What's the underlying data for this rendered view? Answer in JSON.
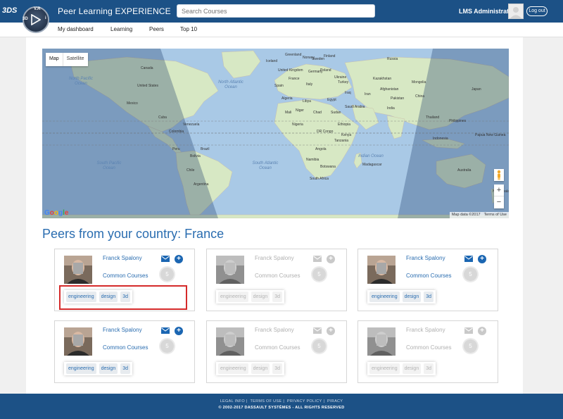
{
  "header": {
    "brand_mark": "3DS",
    "app_title": "Peer Learning EXPERIENCE",
    "search_placeholder": "Search Courses",
    "user_name": "LMS Administrator",
    "logout_label": "Log out",
    "compass_letters": {
      "n": "V.R",
      "w": "3D",
      "e": "i"
    }
  },
  "nav": {
    "items": [
      {
        "label": "My dashboard"
      },
      {
        "label": "Learning"
      },
      {
        "label": "Peers"
      },
      {
        "label": "Top 10"
      }
    ]
  },
  "map": {
    "toggle_map": "Map",
    "toggle_satellite": "Satellite",
    "google_logo": "Google",
    "attribution": "Map data ©2017",
    "terms": "Terms of Use",
    "zoom_in": "+",
    "zoom_out": "−",
    "labels": [
      {
        "text": "Greenland"
      },
      {
        "text": "Iceland"
      },
      {
        "text": "Norway"
      },
      {
        "text": "Sweden"
      },
      {
        "text": "Finland"
      },
      {
        "text": "Russia"
      },
      {
        "text": "Canada"
      },
      {
        "text": "United Kingdom"
      },
      {
        "text": "Germany"
      },
      {
        "text": "Poland"
      },
      {
        "text": "Ukraine"
      },
      {
        "text": "Kazakhstan"
      },
      {
        "text": "Mongolia"
      },
      {
        "text": "France"
      },
      {
        "text": "Spain"
      },
      {
        "text": "Italy"
      },
      {
        "text": "Turkey"
      },
      {
        "text": "China"
      },
      {
        "text": "United States"
      },
      {
        "text": "Mexico"
      },
      {
        "text": "Algeria"
      },
      {
        "text": "Libya"
      },
      {
        "text": "Egypt"
      },
      {
        "text": "Iraq"
      },
      {
        "text": "Iran"
      },
      {
        "text": "Afghanistan"
      },
      {
        "text": "Pakistan"
      },
      {
        "text": "India"
      },
      {
        "text": "Saudi Arabia"
      },
      {
        "text": "Mali"
      },
      {
        "text": "Niger"
      },
      {
        "text": "Chad"
      },
      {
        "text": "Sudan"
      },
      {
        "text": "Nigeria"
      },
      {
        "text": "Ethiopia"
      },
      {
        "text": "DR Congo"
      },
      {
        "text": "Kenya"
      },
      {
        "text": "Tanzania"
      },
      {
        "text": "Angola"
      },
      {
        "text": "Namibia"
      },
      {
        "text": "Botswana"
      },
      {
        "text": "Madagascar"
      },
      {
        "text": "South Africa"
      },
      {
        "text": "Cuba"
      },
      {
        "text": "Venezuela"
      },
      {
        "text": "Colombia"
      },
      {
        "text": "Peru"
      },
      {
        "text": "Brazil"
      },
      {
        "text": "Bolivia"
      },
      {
        "text": "Chile"
      },
      {
        "text": "Argentina"
      },
      {
        "text": "Indonesia"
      },
      {
        "text": "Philippines"
      },
      {
        "text": "Papua New Guinea"
      },
      {
        "text": "Australia"
      },
      {
        "text": "New Zealand"
      },
      {
        "text": "Japan"
      },
      {
        "text": "Thailand"
      }
    ],
    "oceans": [
      "North Atlantic Ocean",
      "South Atlantic Ocean",
      "Indian Ocean",
      "South Pacific Ocean",
      "North Pacific Ocean"
    ]
  },
  "peers": {
    "heading": "Peers from your country: France",
    "cards": [
      {
        "name": "Franck Spalony",
        "common_label": "Common Courses",
        "count": "5",
        "tags": [
          "engineering",
          "design",
          "3d"
        ],
        "active": true
      },
      {
        "name": "Franck Spalony",
        "common_label": "Common Courses",
        "count": "5",
        "tags": [
          "engineering",
          "design",
          "3d"
        ],
        "active": false
      },
      {
        "name": "Franck Spalony",
        "common_label": "Common Courses",
        "count": "5",
        "tags": [
          "engineering",
          "design",
          "3d"
        ],
        "active": true
      },
      {
        "name": "Franck Spalony",
        "common_label": "Common Courses",
        "count": "5",
        "tags": [
          "engineering",
          "design",
          "3d"
        ],
        "active": true
      },
      {
        "name": "Franck Spalony",
        "common_label": "Common Courses",
        "count": "5",
        "tags": [
          "engineering",
          "design",
          "3d"
        ],
        "active": false
      },
      {
        "name": "Franck Spalony",
        "common_label": "Common Courses",
        "count": "5",
        "tags": [
          "engineering",
          "design",
          "3d"
        ],
        "active": false
      }
    ]
  },
  "footer": {
    "links": [
      "LEGAL INFO",
      "TERMS OF USE",
      "PRIVACY POLICY",
      "PIRACY"
    ],
    "copyright": "© 2002-2017 DASSAULT SYSTÈMES - ALL RIGHTS RESERVED"
  },
  "colors": {
    "header_bg": "#1c5186",
    "link_blue": "#2a6db0",
    "ocean": "#a9c9e6",
    "land": "#d7e8c4",
    "highlight_red": "#d52a2a"
  }
}
